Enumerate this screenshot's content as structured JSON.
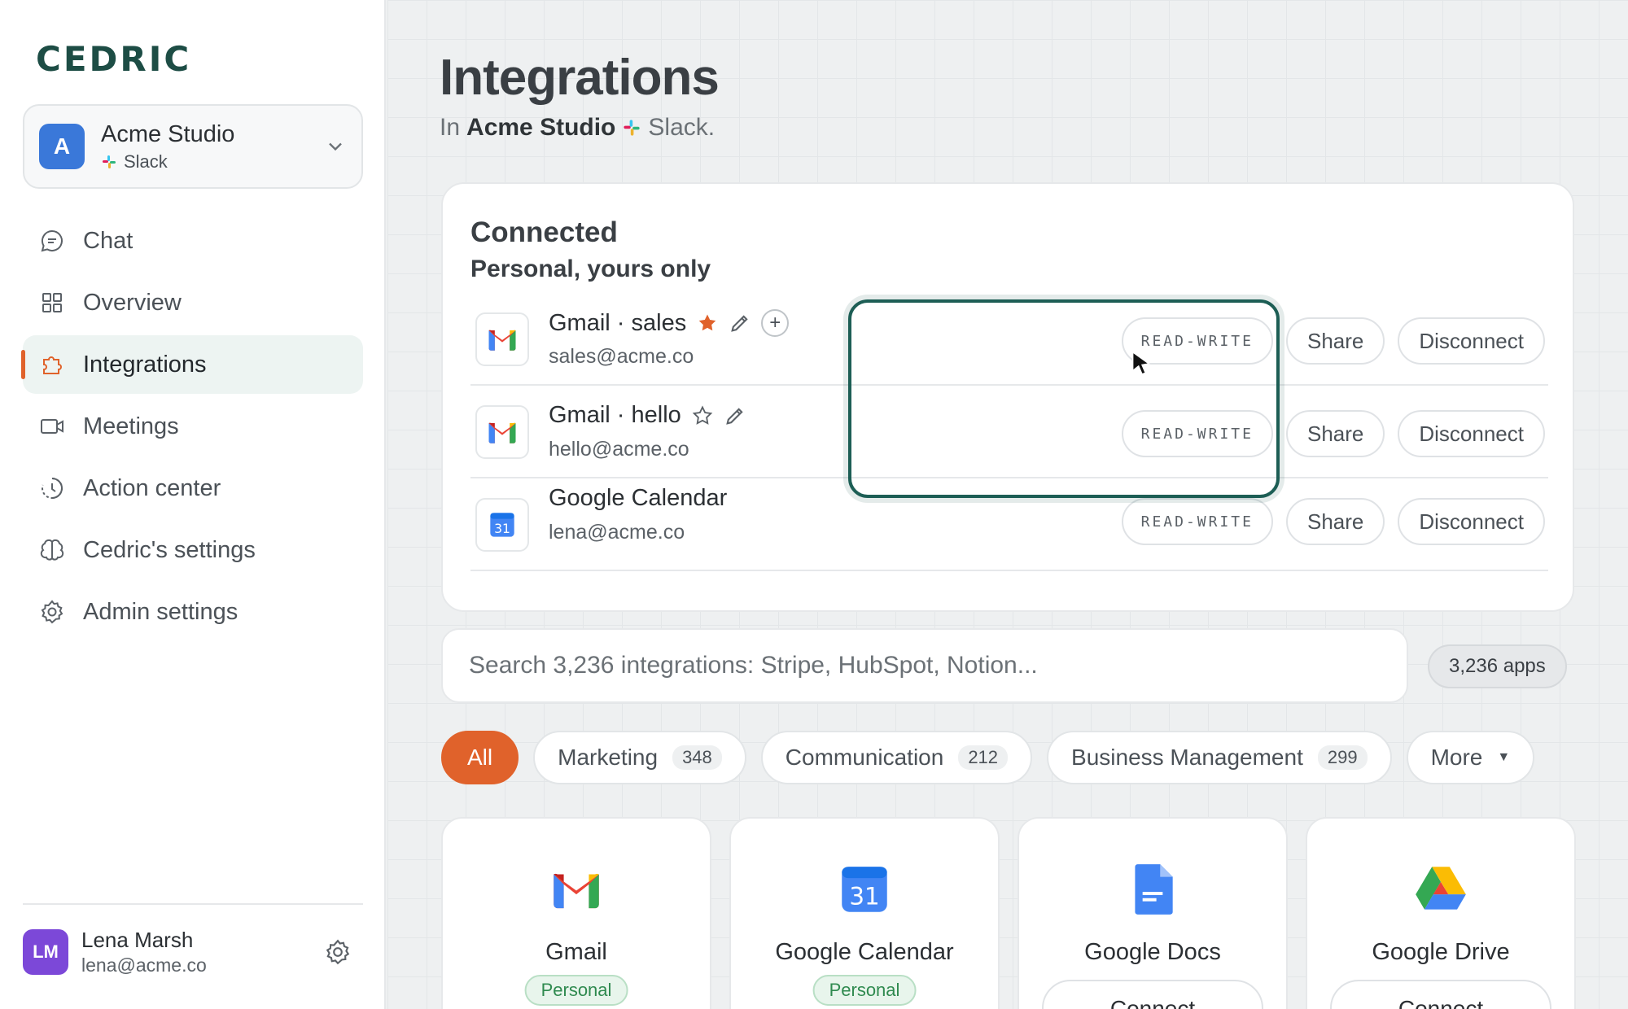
{
  "sidebar": {
    "brand": "CEDRIC",
    "workspace": {
      "initial": "A",
      "name": "Acme Studio",
      "platform": "Slack"
    },
    "nav": [
      {
        "label": "Chat",
        "icon": "chat-icon"
      },
      {
        "label": "Overview",
        "icon": "grid-icon"
      },
      {
        "label": "Integrations",
        "icon": "puzzle-icon",
        "active": true
      },
      {
        "label": "Meetings",
        "icon": "video-icon"
      },
      {
        "label": "Action center",
        "icon": "clock-icon"
      },
      {
        "label": "Cedric's settings",
        "icon": "brain-icon"
      },
      {
        "label": "Admin settings",
        "icon": "gear-icon"
      }
    ],
    "user": {
      "initials": "LM",
      "name": "Lena Marsh",
      "email": "lena@acme.co"
    }
  },
  "main": {
    "title": "Integrations",
    "subtitle_prefix": "In",
    "subtitle_workspace": "Acme Studio",
    "subtitle_platform": "Slack.",
    "connected": {
      "title": "Connected",
      "subtitle": "Personal, yours only",
      "rows": [
        {
          "name": "Gmail · sales",
          "email": "sales@acme.co",
          "icon": "gmail-icon",
          "starred": true,
          "permission": "READ-WRITE",
          "share": "Share",
          "disconnect": "Disconnect"
        },
        {
          "name": "Gmail · hello",
          "email": "hello@acme.co",
          "icon": "gmail-icon",
          "starred": false,
          "permission": "READ-WRITE",
          "share": "Share",
          "disconnect": "Disconnect"
        },
        {
          "name": "Google Calendar",
          "email": "lena@acme.co",
          "icon": "google-calendar-icon",
          "permission": "READ-WRITE",
          "share": "Share",
          "disconnect": "Disconnect"
        }
      ]
    },
    "search": {
      "placeholder": "Search 3,236 integrations: Stripe, HubSpot, Notion...",
      "value": ""
    },
    "apps_count": "3,236 apps",
    "chips": [
      {
        "label": "All",
        "count": ""
      },
      {
        "label": "Marketing",
        "count": "348"
      },
      {
        "label": "Communication",
        "count": "212"
      },
      {
        "label": "Business Management",
        "count": "299"
      },
      {
        "label": "More",
        "count": ""
      }
    ],
    "catalog": [
      {
        "name": "Gmail",
        "status": "Personal"
      },
      {
        "name": "Google Calendar",
        "status": "Personal"
      },
      {
        "name": "Google Docs",
        "action": "Connect"
      },
      {
        "name": "Google Drive",
        "action": "Connect"
      }
    ]
  },
  "colors": {
    "brand": "#1d4d45",
    "accent": "#e0622b",
    "highlight": "#1d5e55",
    "workspace_avatar": "#3a78d9",
    "user_avatar": "#7c48d8"
  }
}
